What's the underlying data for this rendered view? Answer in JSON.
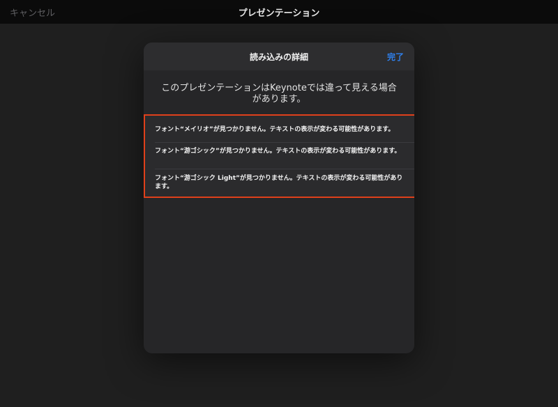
{
  "topbar": {
    "cancel_label": "キャンセル",
    "title": "プレゼンテーション"
  },
  "sheet": {
    "title": "読み込みの詳細",
    "done_label": "完了",
    "message": "このプレゼンテーションはKeynoteでは違って見える場合があります。",
    "warnings": [
      "フォント“メイリオ”が見つかりません。テキストの表示が変わる可能性があります。",
      "フォント“游ゴシック”が見つかりません。テキストの表示が変わる可能性があります。",
      "フォント“游ゴシック Light”が見つかりません。テキストの表示が変わる可能性があります。"
    ]
  },
  "colors": {
    "accent": "#2f80ed",
    "highlight_border": "#e0401b"
  }
}
